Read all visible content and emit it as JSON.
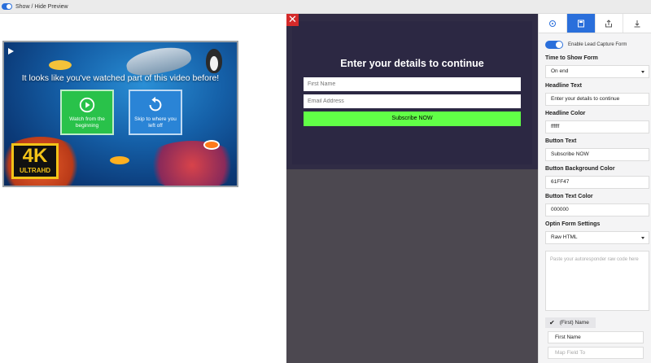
{
  "topbar": {
    "label": "Show / Hide Preview"
  },
  "video": {
    "headline": "It looks like you've watched part of this video before!",
    "watch_button": "Watch from the beginning",
    "skip_button": "Skip to where you left off",
    "badge_big": "4K",
    "badge_small": "ULTRAHD"
  },
  "form": {
    "close": "✕",
    "title": "Enter your details to continue",
    "first_name_placeholder": "First Name",
    "email_placeholder": "Email Address",
    "submit_label": "Subscribe NOW"
  },
  "sidebar": {
    "tabs": [
      "target-icon",
      "save-icon",
      "share-icon",
      "download-icon"
    ],
    "enable_label": "Enable Lead Capture Form",
    "time_label": "Time to Show Form",
    "time_value": "On end",
    "headline_label": "Headline Text",
    "headline_value": "Enter your details to continue",
    "headline_color_label": "Headline Color",
    "headline_color_value": "ffffff",
    "button_text_label": "Button Text",
    "button_text_value": "Subscribe NOW",
    "button_bg_label": "Button Background Color",
    "button_bg_value": "61FF47",
    "button_text_color_label": "Button Text Color",
    "button_text_color_value": "000000",
    "optin_label": "Optin Form Settings",
    "optin_value": "Raw HTML",
    "textarea_placeholder": "Paste your autoresponder raw code here",
    "first_name_check": "(First) Name",
    "first_name_field": "First Name",
    "map_field_placeholder": "Map Field To"
  },
  "colors": {
    "accent": "#2a6fdb",
    "submit_bg": "#61FF47",
    "form_bg": "#2c2843"
  }
}
